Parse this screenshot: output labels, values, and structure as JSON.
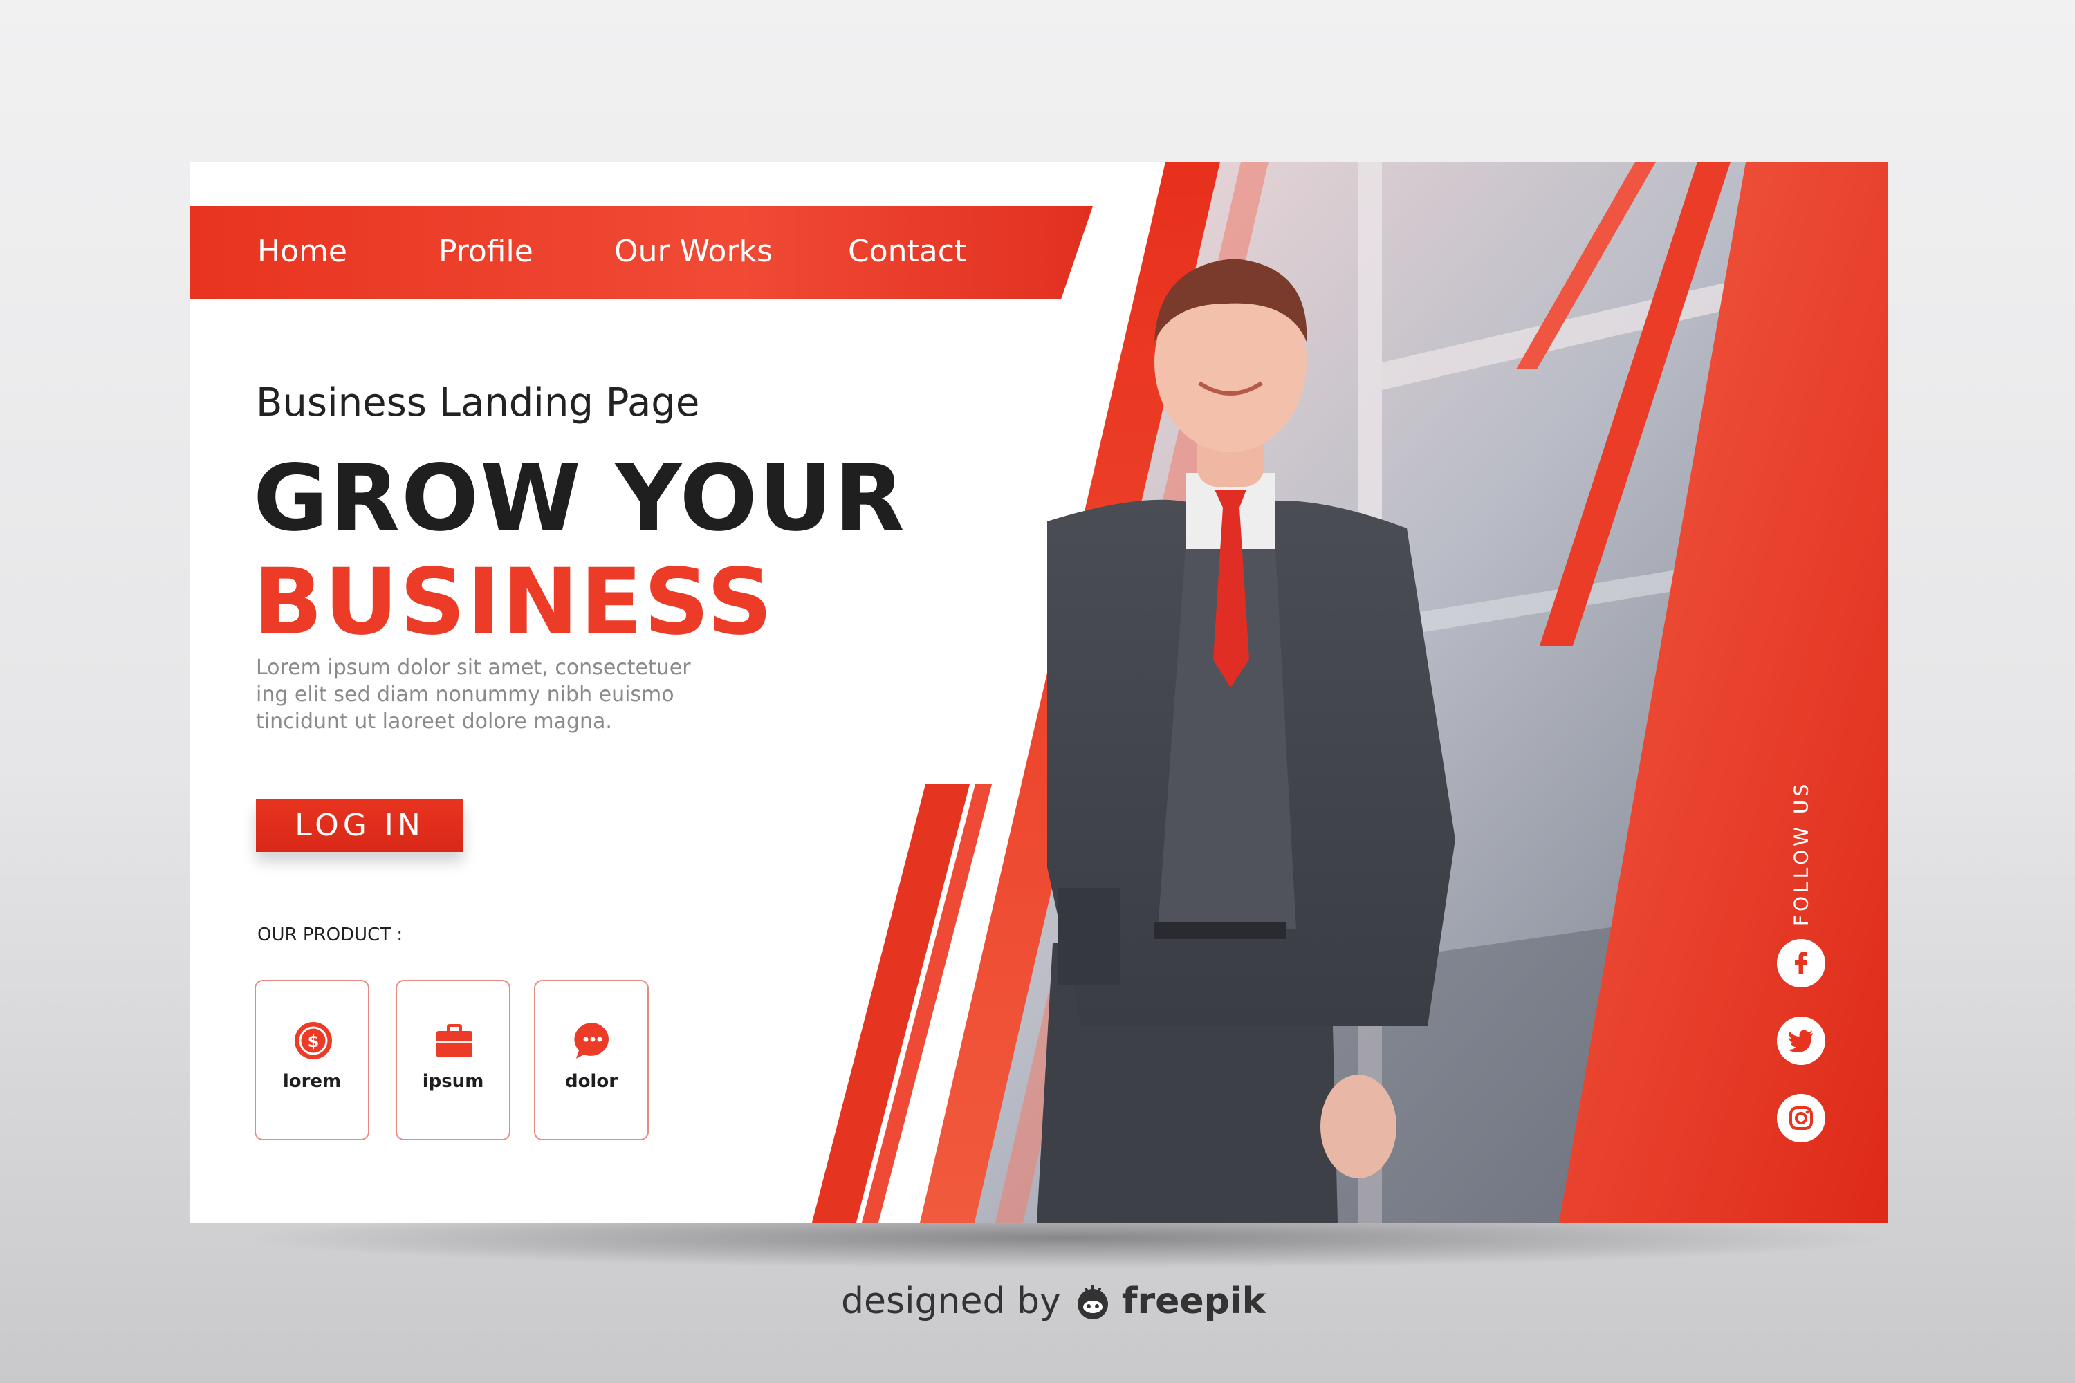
{
  "nav": {
    "items": [
      {
        "label": "Home"
      },
      {
        "label": "Profile"
      },
      {
        "label": "Our Works"
      },
      {
        "label": "Contact"
      }
    ]
  },
  "hero": {
    "subtitle": "Business Landing Page",
    "headline_line1": "GROW YOUR",
    "headline_line2": "BUSINESS",
    "body_line1": "Lorem ipsum dolor sit amet, consectetuer",
    "body_line2": "ing elit sed diam nonummy nibh euismo",
    "body_line3": "tincidunt ut laoreet dolore magna.",
    "login_label": "LOG IN"
  },
  "products": {
    "label": "OUR PRODUCT :",
    "items": [
      {
        "label": "lorem",
        "icon": "dollar-coin-icon"
      },
      {
        "label": "ipsum",
        "icon": "briefcase-icon"
      },
      {
        "label": "dolor",
        "icon": "chat-bubble-icon"
      }
    ]
  },
  "social": {
    "label": "FOLLOW US",
    "items": [
      {
        "icon": "facebook-icon"
      },
      {
        "icon": "twitter-icon"
      },
      {
        "icon": "instagram-icon"
      }
    ]
  },
  "credit": {
    "prefix": "designed by",
    "brand": "freepik"
  },
  "colors": {
    "accent": "#ec3b27",
    "accent_dark": "#d92818",
    "text_dark": "#1f1f1f",
    "text_muted": "#8a8a8a"
  }
}
